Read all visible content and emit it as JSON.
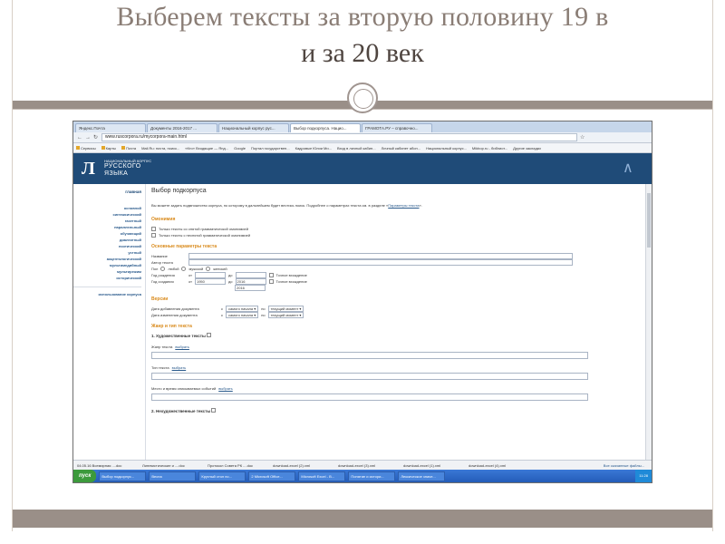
{
  "slide": {
    "title_line1": "Выберем тексты за вторую половину 19 в",
    "title_line2": "и за 20 век"
  },
  "browser": {
    "tabs": [
      "Яндекс.Почта",
      "Документы 2016-2017 ...",
      "Национальный корпус рус...",
      "Выбор подкорпуса. Нацио...",
      "ГРАМОТА.РУ – справочно..."
    ],
    "url": "www.ruscorpora.ru/mycorpora-main.html",
    "bookmarks": [
      "Сервисы",
      "Карты",
      "Почта",
      "Mail.Ru: почта, поиск...",
      "«Кто» Входящие — Янд...",
      "Google",
      "Портал государствен...",
      "Кадровые Юлии Ми...",
      "Вход в личный кабин...",
      "Личный кабинет абон...",
      "Национальный корпус...",
      "Mikbop.ru - библиот...",
      "Другие закладки"
    ]
  },
  "site": {
    "logo_small": "НАЦИОНАЛЬНЫЙ КОРПУС",
    "logo_line1": "РУССКОГО",
    "logo_line2": "ЯЗЫКА",
    "nav": {
      "main": "главная",
      "items": [
        "основной",
        "синтаксический",
        "газетный",
        "параллельный",
        "обучающий",
        "диалектный",
        "поэтический",
        "устный",
        "акцентологический",
        "мультимедийный",
        "мультирежим",
        "исторический"
      ],
      "footer": "использование корпуса"
    }
  },
  "form": {
    "title": "Выбор подкорпуса",
    "description": "Вы можете задать подмножество корпуса, по которому в дальнейшем будет вестись поиск. Подробнее о параметрах текста см. в разделе «",
    "description_link": "Параметры текста",
    "description_end": "».",
    "homonymy": {
      "heading": "Омонимия",
      "opt1": "Только тексты со снятой грамматической омонимией",
      "opt2": "Только тексты с неснятой грамматической омонимией"
    },
    "basic": {
      "heading": "Основные параметры текста",
      "name_label": "Название",
      "author_label": "Автор текста",
      "gender_label": "Пол",
      "gender_any": "любой",
      "gender_male": "мужской",
      "gender_female": "женский",
      "birth_label": "Год рождения",
      "from": "от",
      "to": "до",
      "exact_birth": "Точное вхождение",
      "created_label": "Год создания",
      "created_from": "1950",
      "created_to": "2016",
      "exact_created": "Точное вхождение",
      "extra": "2016"
    },
    "versions": {
      "heading": "Версии",
      "added_label": "Дата добавления документа",
      "changed_label": "Дата изменения документа",
      "since": "с",
      "till": "по",
      "start_opt": "самого начала",
      "now_opt": "текущий момент"
    },
    "genre": {
      "heading": "Жанр и тип текста",
      "fiction": "1. Художественные тексты",
      "genre_label": "Жанр текста",
      "type_label": "Тип текста",
      "place_label": "Место и время описываемых событий",
      "choose": "выбрать",
      "nonfiction": "2. Нехудожественные тексты"
    }
  },
  "downloads": {
    "items": [
      "04.05.16 Всемирная ....doc",
      "Лингвистические и ....doc",
      "Протокол Совета РК ....doc",
      "download-excel (2).xml",
      "download-excel (3).xml",
      "download-excel (1).xml",
      "download-excel (4).xml"
    ],
    "show_all": "Все скачанные файлы..."
  },
  "taskbar": {
    "start": "пуск",
    "tasks": [
      "Выбор подкорпус...",
      "Весна",
      "Круглый стол по...",
      "2 Microsoft Office...",
      "Microsoft Excel - B...",
      "Понятие и истори...",
      "Лексическое значе..."
    ],
    "clock": "11:28"
  }
}
